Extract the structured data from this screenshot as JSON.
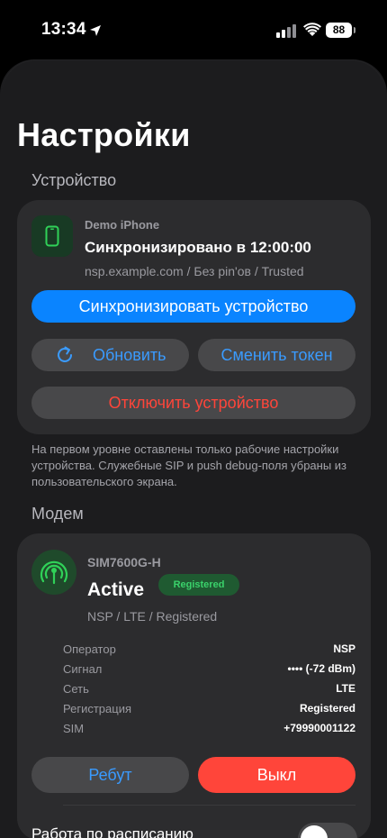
{
  "status_bar": {
    "time": "13:34",
    "battery": "88"
  },
  "page": {
    "title": "Настройки"
  },
  "device_section": {
    "label": "Устройство",
    "device_name": "Demo iPhone",
    "sync_status": "Синхронизировано в 12:00:00",
    "details": "nsp.example.com / Без pin'ов / Trusted",
    "sync_button": "Синхронизировать устройство",
    "refresh_button": "Обновить",
    "change_token_button": "Сменить токен",
    "disconnect_button": "Отключить устройство",
    "accent_color": "#0a84ff",
    "danger_color": "#ff453a"
  },
  "note": "На первом уровне оставлены только рабочие настройки устройства. Служебные SIP и push debug-поля убраны из пользовательского экрана.",
  "modem_section": {
    "label": "Модем",
    "model": "SIM7600G-H",
    "state": "Active",
    "badge": "Registered",
    "summary": "NSP / LTE / Registered",
    "rows": [
      {
        "key": "Оператор",
        "value": "NSP"
      },
      {
        "key": "Сигнал",
        "value": "•••• (-72 dBm)"
      },
      {
        "key": "Сеть",
        "value": "LTE"
      },
      {
        "key": "Регистрация",
        "value": "Registered"
      },
      {
        "key": "SIM",
        "value": "+79990001122"
      }
    ],
    "reboot_button": "Ребут",
    "off_button": "Выкл",
    "schedule_label": "Работа по расписанию",
    "schedule_enabled": false
  }
}
